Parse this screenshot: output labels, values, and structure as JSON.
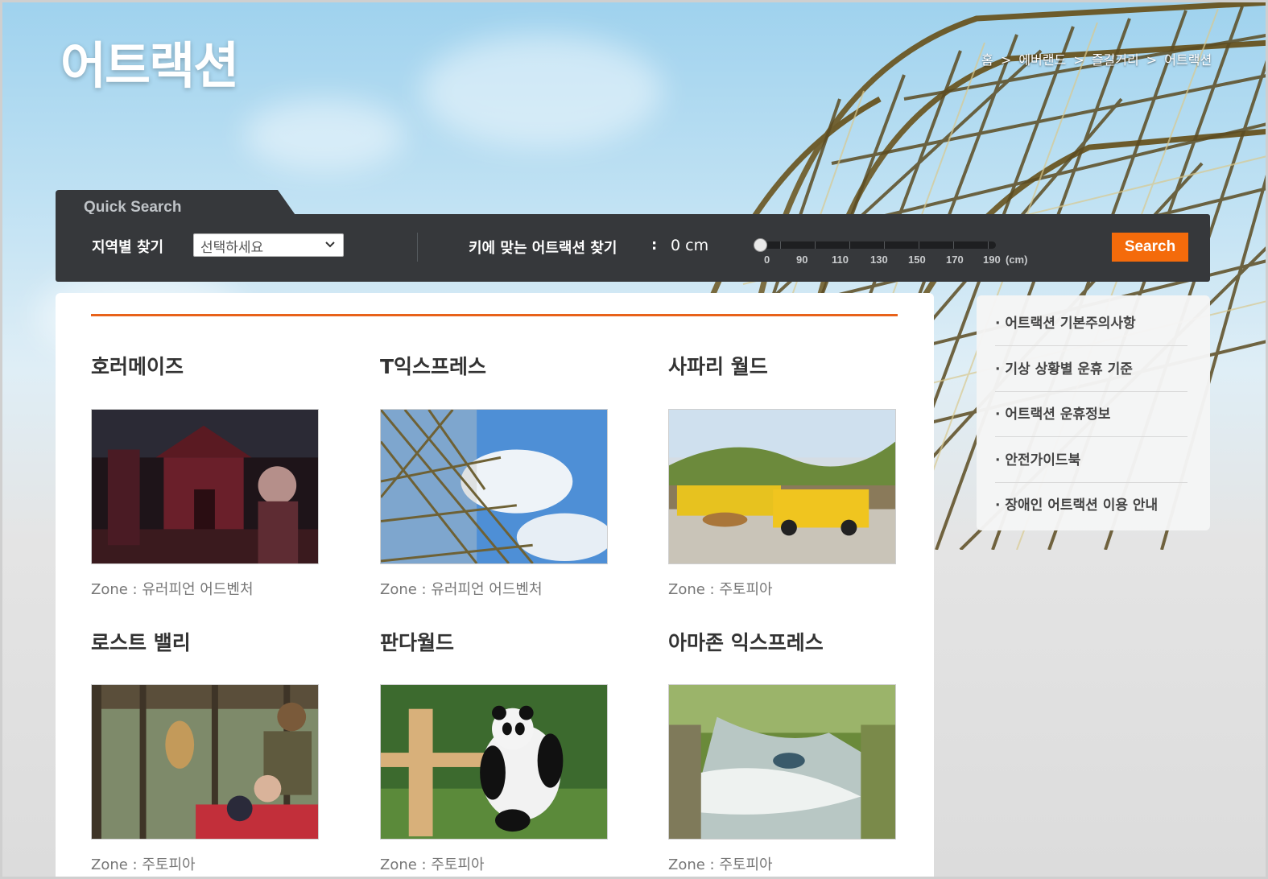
{
  "page": {
    "title": "어트랙션",
    "breadcrumb": [
      "홈",
      ">",
      "에버랜드",
      ">",
      "즐길거리",
      ">",
      "어트랙션"
    ]
  },
  "quick_search": {
    "tab_label": "Quick Search",
    "region_label": "지역별 찾기",
    "region_select": "선택하세요",
    "height_label": "키에 맞는 어트랙션 찾기",
    "colon": ":",
    "height_value": "0 cm",
    "slider_ticks": [
      "0",
      "90",
      "110",
      "130",
      "150",
      "170",
      "190"
    ],
    "slider_unit": "(cm)",
    "slider_value_cm": 0,
    "search_button": "Search"
  },
  "attractions": [
    {
      "title": "호러메이즈",
      "zone": "Zone : 유러피언 어드벤처",
      "image": "horror-maze-image"
    },
    {
      "title": "T익스프레스",
      "zone": "Zone : 유러피언 어드벤처",
      "image": "t-express-image"
    },
    {
      "title": "사파리 월드",
      "zone": "Zone : 주토피아",
      "image": "safari-world-image"
    },
    {
      "title": "로스트 밸리",
      "zone": "Zone : 주토피아",
      "image": "lost-valley-image"
    },
    {
      "title": "판다월드",
      "zone": "Zone : 주토피아",
      "image": "panda-world-image"
    },
    {
      "title": "아마존 익스프레스",
      "zone": "Zone : 주토피아",
      "image": "amazon-express-image"
    }
  ],
  "side_menu": [
    "· 어트랙션 기본주의사항",
    "· 기상 상황별 운휴 기준",
    "· 어트랙션 운휴정보",
    "· 안전가이드북",
    "· 장애인 어트랙션 이용 안내"
  ],
  "colors": {
    "accent": "#f46b0b",
    "search_bar": "#36383b",
    "divider": "#e8621a"
  }
}
